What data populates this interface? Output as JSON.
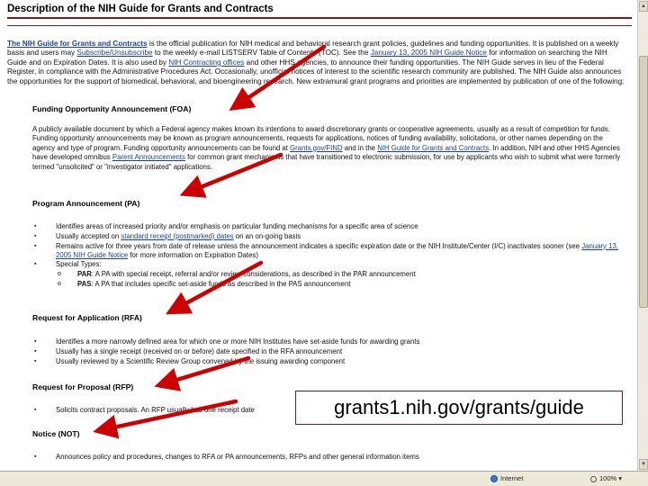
{
  "page_title": "Description of the NIH Guide for Grants and Contracts",
  "intro": {
    "part1_link": "The NIH Guide for Grants and Contracts",
    "part1_text": " is the official publication for NIH medical and behavioral research grant policies, guidelines and funding opportunities. It is published on a weekly basis and users may ",
    "subscribe_link": "Subscribe/Unsubscribe",
    "part2_text": " to the weekly e-mail LISTSERV Table of Contents (TOC). See the ",
    "notice_link": "January 13, 2005 NIH Guide Notice",
    "part3_text": " for information on searching the NIH Guide and on Expiration Dates. It is also used by ",
    "offices_link": "NIH Contracting offices",
    "part4_text": " and other HHS agencies, to announce their funding opportunities. The NIH Guide serves in lieu of the Federal Register, in compliance with the Administrative Procedures Act. Occasionally, unofficial notices of interest to the scientific research community are published. The NIH Guide also announces the opportunities for the support of biomedical, behavioral, and bioengineering research. New extramural grant programs and priorities are implemented by publication of one of the following:"
  },
  "sections": {
    "foa": {
      "heading": "Funding Opportunity Announcement (FOA)",
      "text1": "A publicly available document by which a Federal agency makes known its intentions to award discretionary grants or cooperative agreements, usually as a result of competition for funds. Funding opportunity announcements may be known as program announcements, requests for applications, notices of funding availability, solicitations, or other names depending on the agency and type of program. Funding opportunity announcements can be found at ",
      "link1": "Grants.gov/FIND",
      "text2": " and in the ",
      "link2": "NIH Guide for Grants and Contracts",
      "text3": ". In addition, NIH and other HHS Agencies have developed omnibus ",
      "link3": "Parent Announcements",
      "text4": " for common grant mechanisms that have transitioned to electronic submission, for use by applicants who wish to submit what were formerly termed \"unsolicited\" or \"investigator initiated\" applications."
    },
    "pa": {
      "heading": "Program Announcement (PA)",
      "items": [
        {
          "text": "Identifies areas of increased priority and/or emphasis on particular funding mechanisms for a specific area of science"
        },
        {
          "pre": "Usually accepted on ",
          "link": "standard receipt (postmarked) dates",
          "post": " on an on-going basis"
        },
        {
          "pre": "Remains active for three years from date of release unless the announcement indicates a specific expiration date or the NIH Institute/Center (I/C) inactivates sooner (see ",
          "link": "January 13, 2005 NIH Guide Notice",
          "post": " for more information on Expiration Dates)"
        },
        {
          "text": "Special Types:"
        }
      ],
      "sub_items": [
        {
          "bold": "PAR",
          "text": ": A PA with special receipt, referral and/or review considerations, as described in the PAR announcement"
        },
        {
          "bold": "PAS",
          "text": ": A PA that includes specific set-aside funds as described in the PAS announcement"
        }
      ]
    },
    "rfa": {
      "heading": "Request for Application (RFA)",
      "items": [
        "Identifies a more narrowly defined area for which one or more NIH Institutes have set-aside funds for awarding grants",
        "Usually has a single receipt (received on or before) date specified in the RFA announcement",
        "Usually reviewed by a Scientific Review Group convened by the issuing awarding component"
      ]
    },
    "rfp": {
      "heading": "Request for Proposal (RFP)",
      "items": [
        "Solicits contract proposals. An RFP usually has one receipt date"
      ]
    },
    "not": {
      "heading": "Notice (NOT)",
      "items": [
        "Announces policy and procedures, changes to RFA or PA announcements, RFPs and other general information items"
      ]
    }
  },
  "caption": "grants1.nih.gov/grants/guide",
  "status_bar": {
    "zone_label": "Internet",
    "zoom": "100%"
  },
  "colors": {
    "rule": "#7a1a1a",
    "link": "#1a3fa8",
    "arrow": "#cc0000"
  },
  "icons": [
    "globe-icon",
    "zoom-icon",
    "scroll-up-arrow-icon",
    "scroll-down-arrow-icon"
  ]
}
